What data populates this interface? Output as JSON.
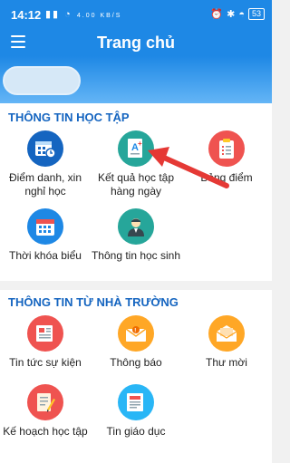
{
  "status_bar": {
    "time": "14:12",
    "net_speed": "4.00 KB/S",
    "battery": "53"
  },
  "app_bar": {
    "title": "Trang chủ"
  },
  "section_learning": {
    "title": "THÔNG TIN HỌC TẬP",
    "items": [
      {
        "label": "Điểm danh, xin nghỉ học",
        "icon": "calendar-clock-icon",
        "color": "#1565c0"
      },
      {
        "label": "Kết quả học tập hàng ngày",
        "icon": "grade-a-icon",
        "color": "#26a69a"
      },
      {
        "label": "Bảng điểm",
        "icon": "clipboard-icon",
        "color": "#ef5350"
      },
      {
        "label": "Thời khóa biểu",
        "icon": "calendar-icon",
        "color": "#1e88e5"
      },
      {
        "label": "Thông tin học sinh",
        "icon": "student-icon",
        "color": "#26a69a"
      }
    ]
  },
  "section_school": {
    "title": "THÔNG TIN TỪ NHÀ TRƯỜNG",
    "items": [
      {
        "label": "Tin tức sự kiện",
        "icon": "newspaper-icon",
        "color": "#ef5350"
      },
      {
        "label": "Thông báo",
        "icon": "notice-icon",
        "color": "#ffa726"
      },
      {
        "label": "Thư mời",
        "icon": "invitation-icon",
        "color": "#ffa726"
      },
      {
        "label": "Kế hoạch học tập",
        "icon": "study-plan-icon",
        "color": "#ef5350"
      },
      {
        "label": "Tin giáo dục",
        "icon": "education-news-icon",
        "color": "#29b6f6"
      }
    ]
  },
  "annotation": {
    "arrow_color": "#e53935"
  }
}
